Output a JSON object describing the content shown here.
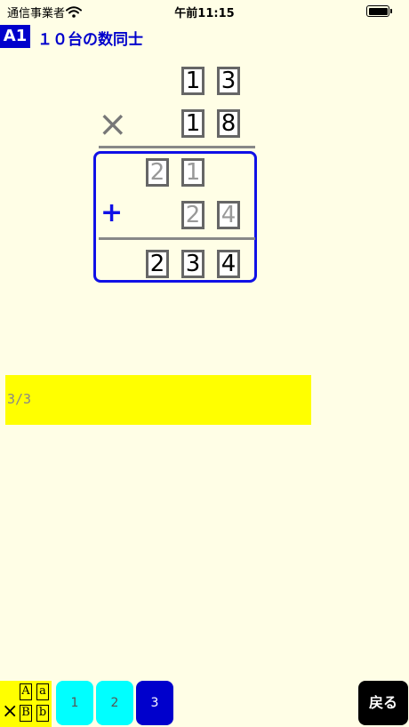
{
  "status_bar": {
    "carrier": "通信事業者",
    "time": "午前11:15"
  },
  "header": {
    "level": "A1",
    "title": "１０台の数同士"
  },
  "problem": {
    "multiplicand": [
      "1",
      "3"
    ],
    "multiplier": [
      "1",
      "8"
    ],
    "times_sign": "×",
    "partial_1": [
      "2",
      "1"
    ],
    "partial_2": [
      "2",
      "4"
    ],
    "plus_sign": "+",
    "answer": [
      "2",
      "3",
      "4"
    ]
  },
  "progress": {
    "text": "3/3",
    "current": 3,
    "total": 3
  },
  "bottom_bar": {
    "mode_button": {
      "times": "×",
      "letters": [
        "A",
        "a",
        "B",
        "b"
      ]
    },
    "step_buttons": [
      "1",
      "2",
      "3"
    ],
    "active_step": "3",
    "back_label": "戻る"
  },
  "colors": {
    "background": "#fffee6",
    "accent_blue": "#0000cc",
    "box_blue": "#1010e6",
    "highlight_yellow": "#ffff00",
    "step_cyan": "#00ffff"
  }
}
